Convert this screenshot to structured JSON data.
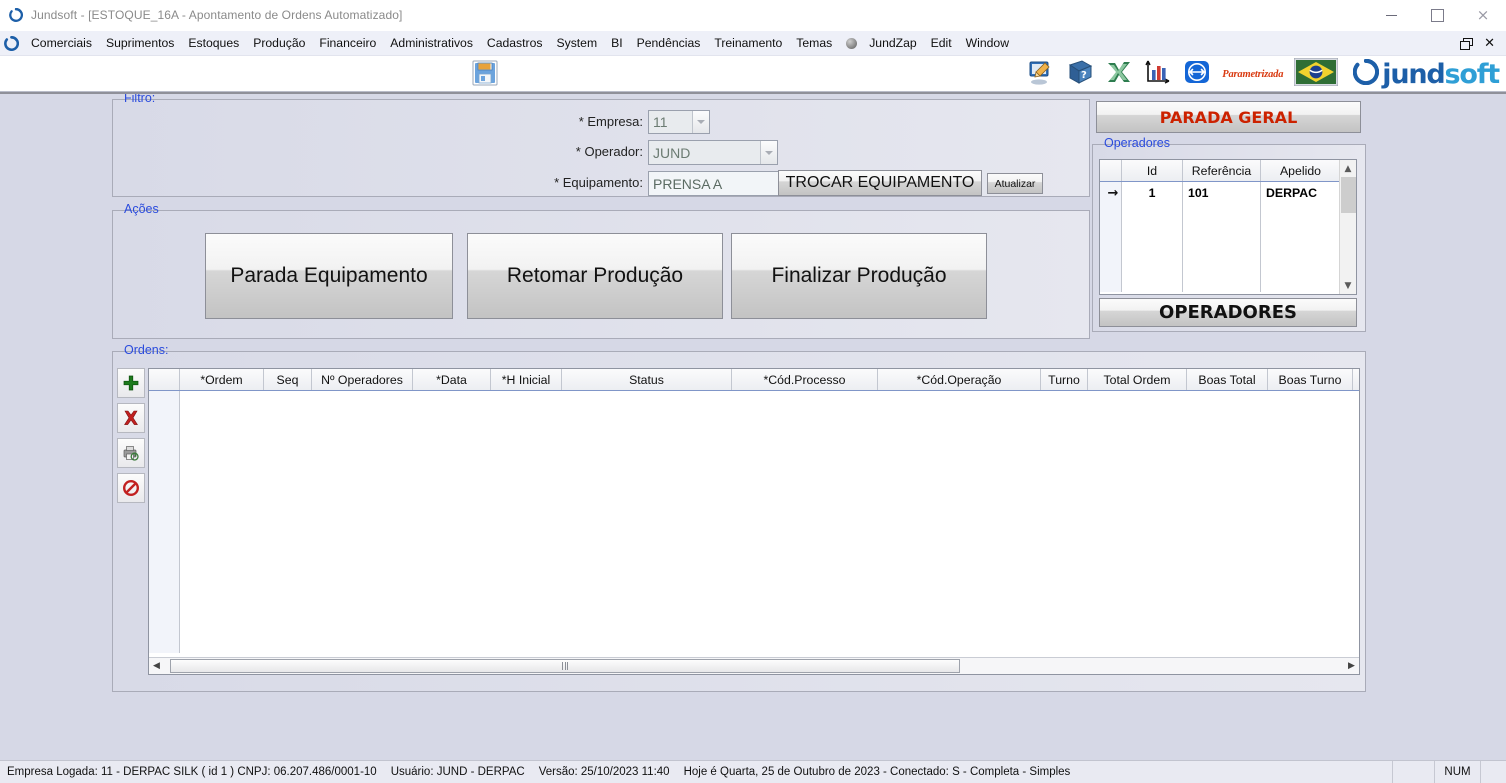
{
  "window": {
    "title": "Jundsoft - [ESTOQUE_16A - Apontamento de Ordens Automatizado]",
    "minimize_label": "",
    "maximize_label": "",
    "close_label": "×"
  },
  "menubar": {
    "items": [
      {
        "label": "Comerciais"
      },
      {
        "label": "Suprimentos"
      },
      {
        "label": "Estoques"
      },
      {
        "label": "Produção"
      },
      {
        "label": "Financeiro"
      },
      {
        "label": "Administrativos"
      },
      {
        "label": "Cadastros"
      },
      {
        "label": "System"
      },
      {
        "label": "BI"
      },
      {
        "label": "Pendências"
      },
      {
        "label": "Treinamento"
      },
      {
        "label": "Temas"
      }
    ],
    "jundzap_label": "JundZap",
    "edit_label": "Edit",
    "window_label": "Window"
  },
  "toolbar": {
    "parametrizada_label": "Parametrizada",
    "brand_j": "jund",
    "brand_s": "soft"
  },
  "filtro": {
    "legend": "Filtro:",
    "empresa_label": "* Empresa:",
    "empresa_value": "11",
    "operador_label": "* Operador:",
    "operador_value": "JUND",
    "equipamento_label": "* Equipamento:",
    "equipamento_value": "PRENSA A",
    "trocar_button": "TROCAR EQUIPAMENTO",
    "atualizar_button": "Atualizar"
  },
  "acoes": {
    "legend": "Ações",
    "buttons": [
      {
        "label": "Parada Equipamento"
      },
      {
        "label": "Retomar Produção"
      },
      {
        "label": "Finalizar Produção"
      }
    ]
  },
  "right_panel": {
    "parada_geral_button": "PARADA GERAL",
    "operadores_legend": "Operadores",
    "operadores_button": "OPERADORES",
    "columns": [
      "",
      "Id",
      "Referência",
      "Apelido"
    ],
    "rows": [
      {
        "marker": "→",
        "id": "1",
        "referencia": "101",
        "apelido": "DERPAC"
      }
    ]
  },
  "ordens": {
    "legend": "Ordens:",
    "columns": [
      "*Ordem",
      "Seq",
      "Nº Operadores",
      "*Data",
      "*H Inicial",
      "Status",
      "*Cód.Processo",
      "*Cód.Operação",
      "Turno",
      "Total Ordem",
      "Boas Total",
      "Boas Turno"
    ],
    "rows": [],
    "tools": [
      {
        "name": "add",
        "glyph": "+"
      },
      {
        "name": "delete",
        "glyph": "✕"
      },
      {
        "name": "print",
        "glyph": "✇"
      },
      {
        "name": "cancel",
        "glyph": "⊘"
      }
    ]
  },
  "statusbar": {
    "empresa": "Empresa Logada: 11 - DERPAC SILK ( id 1 ) CNPJ: 06.207.486/0001-10",
    "usuario": "Usuário: JUND - DERPAC",
    "versao": "Versão: 25/10/2023 11:40",
    "data": "Hoje é Quarta, 25 de Outubro de 2023 - Conectado: S - Completa - Simples",
    "num": "NUM"
  },
  "colors": {
    "accent_blue": "#2a4bdd",
    "danger_red": "#cc2200",
    "client_bg": "#d6d8e6",
    "menubar_bg": "#eef0f8",
    "brand_dark": "#1d5fa8",
    "brand_light": "#2f9fd6"
  }
}
